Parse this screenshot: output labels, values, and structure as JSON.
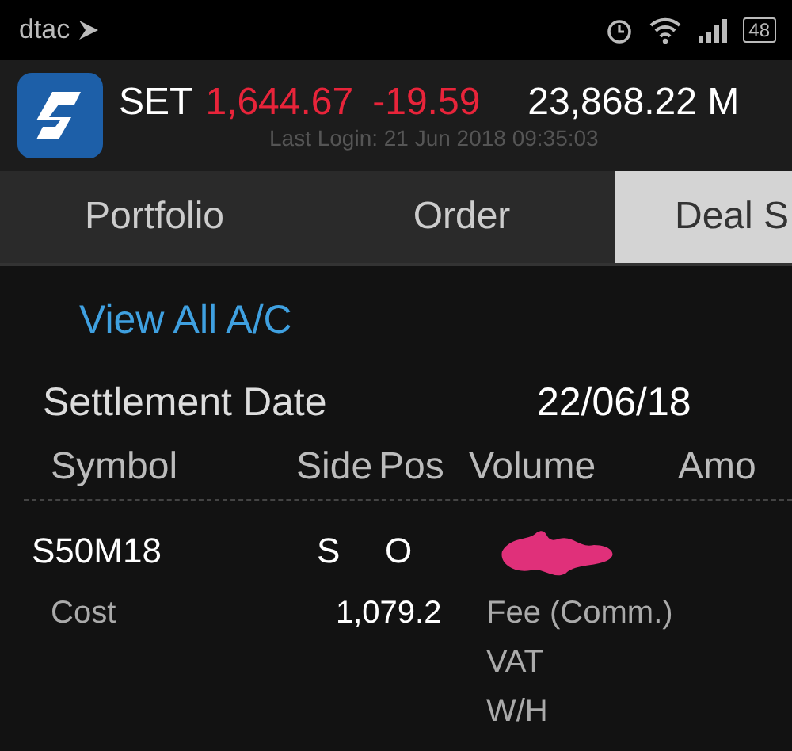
{
  "status_bar": {
    "carrier": "dtac",
    "battery": "48"
  },
  "header": {
    "index_name": "SET",
    "index_value": "1,644.67",
    "change": "-19.59",
    "volume": "23,868.22 M",
    "last_login": "Last Login: 21 Jun 2018 09:35:03"
  },
  "tabs": [
    {
      "label": "Portfolio",
      "selected": false
    },
    {
      "label": "Order",
      "selected": false
    },
    {
      "label": "Deal S",
      "selected": true
    }
  ],
  "view_all_link": "View All A/C",
  "settlement": {
    "label": "Settlement Date",
    "value": "22/06/18"
  },
  "table": {
    "columns": [
      "Symbol",
      "Side",
      "Pos",
      "Volume",
      "Amo"
    ],
    "rows": [
      {
        "symbol": "S50M18",
        "side": "S",
        "pos": "O",
        "volume_redacted": true,
        "cost_label": "Cost",
        "cost": "1,079.2",
        "fees": [
          "Fee (Comm.)",
          "VAT",
          "W/H"
        ]
      }
    ]
  }
}
